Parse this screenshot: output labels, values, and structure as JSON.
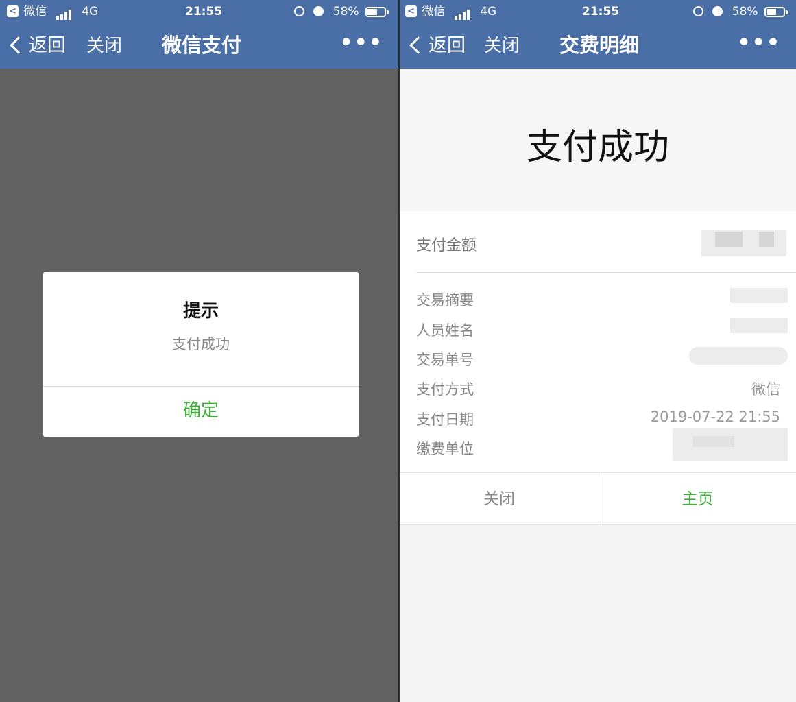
{
  "left": {
    "status": {
      "badge": "<",
      "carrier": "微信",
      "network": "4G",
      "time": "21:55",
      "battery_pct": "58%"
    },
    "nav": {
      "back": "返回",
      "close": "关闭",
      "title": "微信支付",
      "more": "•••"
    },
    "dialog": {
      "title": "提示",
      "message": "支付成功",
      "confirm": "确定"
    }
  },
  "right": {
    "status": {
      "badge": "<",
      "carrier": "微信",
      "network": "4G",
      "time": "21:55",
      "battery_pct": "58%"
    },
    "nav": {
      "back": "返回",
      "close": "关闭",
      "title": "交费明细",
      "more": "•••"
    },
    "hero": "支付成功",
    "amount_label": "支付金额",
    "rows": [
      {
        "label": "交易摘要",
        "value": ""
      },
      {
        "label": "人员姓名",
        "value": ""
      },
      {
        "label": "交易单号",
        "value": ""
      },
      {
        "label": "支付方式",
        "value": "微信"
      },
      {
        "label": "支付日期",
        "value": "2019-07-22 21:55"
      },
      {
        "label": "缴费单位",
        "value": ""
      }
    ],
    "buttons": {
      "close": "关闭",
      "home": "主页"
    }
  },
  "colors": {
    "header": "#4a6ea6",
    "accent_green": "#3cb034",
    "overlay": "#626262"
  },
  "icons": [
    "back-badge-icon",
    "signal-icon",
    "rotation-lock-icon",
    "alarm-icon",
    "battery-icon",
    "chevron-left-icon",
    "more-icon"
  ]
}
